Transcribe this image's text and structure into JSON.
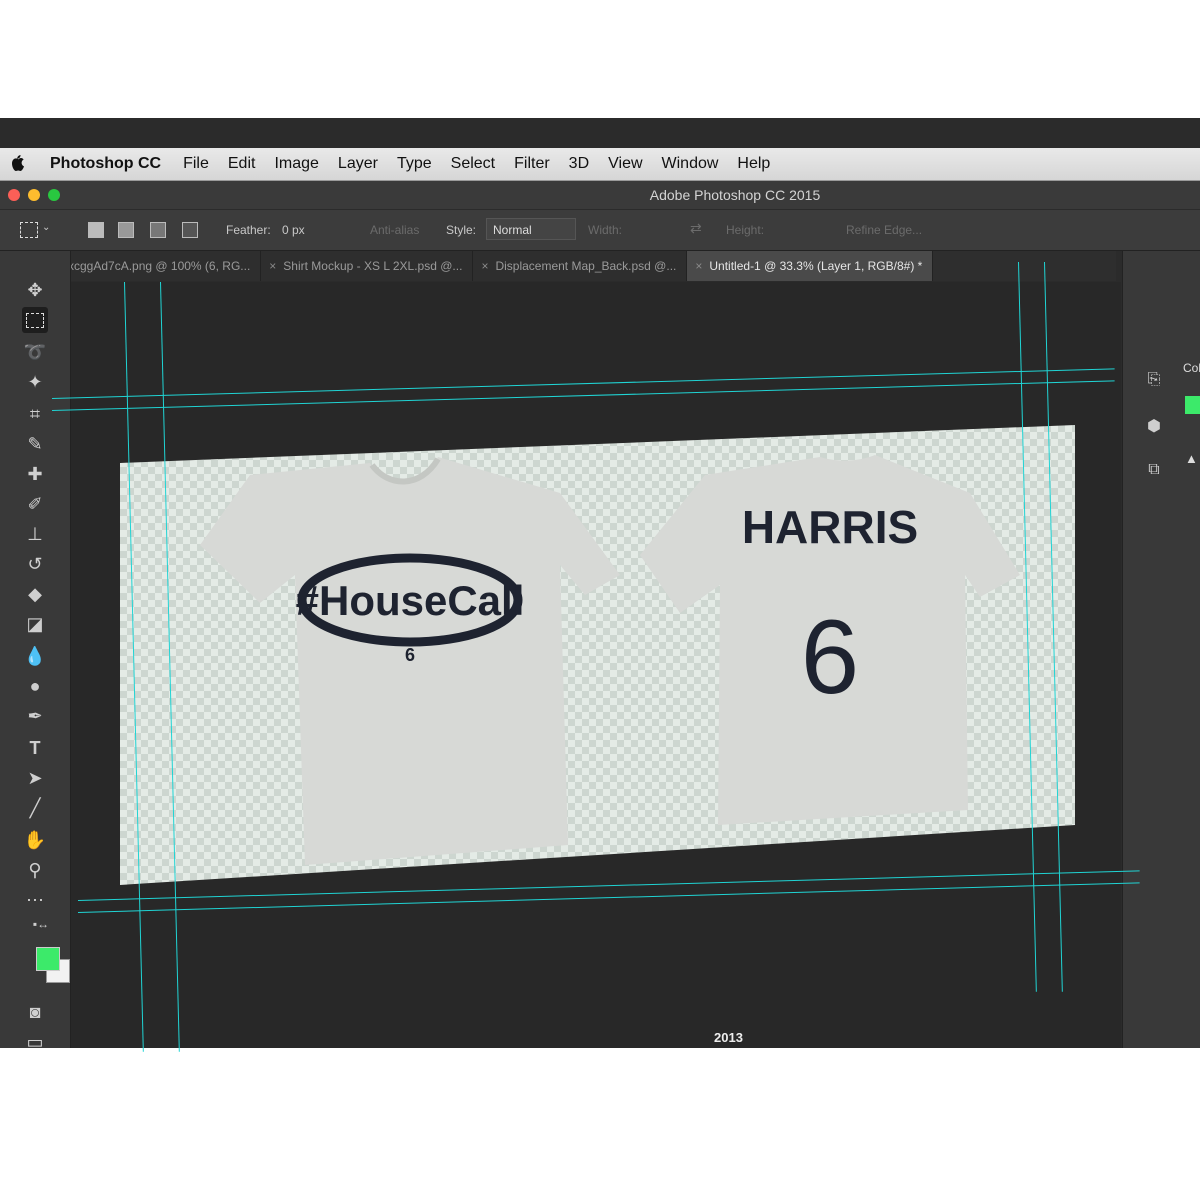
{
  "menubar": {
    "app_name": "Photoshop CC",
    "items": [
      "File",
      "Edit",
      "Image",
      "Layer",
      "Type",
      "Select",
      "Filter",
      "3D",
      "View",
      "Window",
      "Help"
    ]
  },
  "window": {
    "title": "Adobe Photoshop CC 2015"
  },
  "options_bar": {
    "feather_label": "Feather:",
    "feather_value": "0 px",
    "anti_alias_label": "Anti-alias",
    "style_label": "Style:",
    "style_value": "Normal",
    "width_label": "Width:",
    "height_label": "Height:",
    "refine_edge_label": "Refine Edge..."
  },
  "tabs": [
    {
      "label": "xcggAd7cA.png @ 100% (6, RG...",
      "active": false
    },
    {
      "label": "Shirt Mockup - XS L 2XL.psd @...",
      "active": false
    },
    {
      "label": "Displacement Map_Back.psd @...",
      "active": false
    },
    {
      "label": "Untitled-1 @ 33.3% (Layer 1, RGB/8#) *",
      "active": true
    }
  ],
  "tab_close_glyph": "×",
  "right_panel": {
    "color_tab": "Col"
  },
  "canvas": {
    "front_shirt": {
      "hashtag_text": "#HouseCall",
      "number": "6"
    },
    "back_shirt": {
      "name": "HARRIS",
      "number": "6"
    }
  },
  "colors": {
    "foreground": "#3cea6a",
    "background": "#f2f2f2",
    "guide": "#20d4d4",
    "shirt": "#d7d9d6",
    "print": "#1e2330"
  },
  "desk_sticker_text": "2013"
}
